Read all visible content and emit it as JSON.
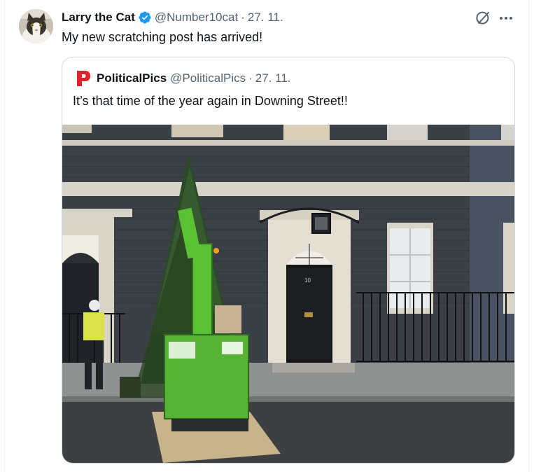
{
  "tweet": {
    "author_name": "Larry the Cat",
    "handle": "@Number10cat",
    "date": "27. 11.",
    "separator": "·",
    "text": "My new scratching post has arrived!"
  },
  "quoted_tweet": {
    "author_name": "PoliticalPics",
    "handle": "@PoliticalPics",
    "date": "27. 11.",
    "separator": "·",
    "text": "It’s that time of the year again in Downing Street!!",
    "door_number": "10"
  },
  "icons": {
    "verified": "verified-badge-icon",
    "grok": "grok-icon",
    "more": "more-options-icon"
  },
  "colors": {
    "verified_blue": "#1d9bf0",
    "text_primary": "#0f1419",
    "text_secondary": "#536471",
    "border": "#cfd9de",
    "logo_red": "#e0202a"
  }
}
